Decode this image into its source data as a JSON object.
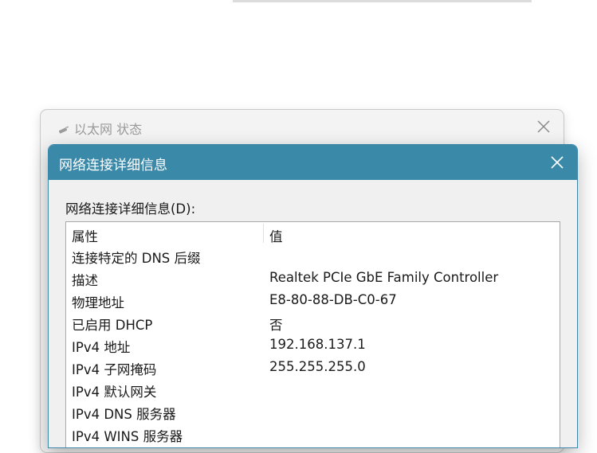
{
  "background_window": {
    "title": "以太网 状态"
  },
  "dialog": {
    "title": "网络连接详细信息",
    "list_label": "网络连接详细信息(D):",
    "columns": {
      "property": "属性",
      "value": "值"
    },
    "rows": [
      {
        "property": "连接特定的 DNS 后缀",
        "value": ""
      },
      {
        "property": "描述",
        "value": "Realtek PCIe GbE Family Controller"
      },
      {
        "property": "物理地址",
        "value": "E8-80-88-DB-C0-67"
      },
      {
        "property": "已启用 DHCP",
        "value": "否"
      },
      {
        "property": "IPv4 地址",
        "value": "192.168.137.1"
      },
      {
        "property": "IPv4 子网掩码",
        "value": "255.255.255.0"
      },
      {
        "property": "IPv4 默认网关",
        "value": ""
      },
      {
        "property": "IPv4 DNS 服务器",
        "value": ""
      },
      {
        "property": "IPv4 WINS 服务器",
        "value": ""
      }
    ]
  },
  "icons": {
    "bg_window_icon": "network-adapter-icon",
    "close": "close-icon"
  },
  "colors": {
    "titlebar": "#3b89a9",
    "dialog_bg": "#f0f0f0"
  }
}
